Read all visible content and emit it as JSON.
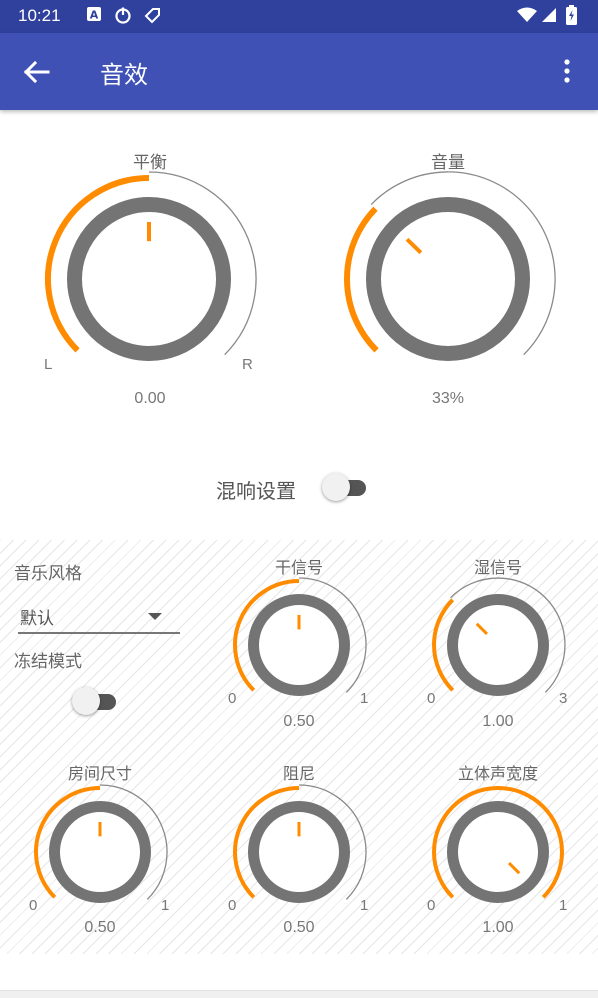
{
  "status_bar": {
    "time": "10:21",
    "left_icons": [
      "a-letter-icon",
      "power-timer-icon",
      "tag-icon"
    ],
    "right_icons": [
      "wifi-icon",
      "signal-icon",
      "battery-charging-icon"
    ]
  },
  "app_bar": {
    "title": "音效",
    "back_icon": "arrow-left-icon",
    "menu_icon": "more-vertical-icon"
  },
  "colors": {
    "app_bar": "#3f51b5",
    "status_bar": "#2f419d",
    "accent": "#ff8c00",
    "knob_ring": "#747474"
  },
  "balance": {
    "title": "平衡",
    "left_label": "L",
    "right_label": "R",
    "value": "0.00",
    "fraction": 0.5
  },
  "volume": {
    "title": "音量",
    "value": "33%",
    "fraction": 0.33
  },
  "reverb_settings": {
    "label": "混响设置",
    "enabled": false,
    "style_label": "音乐风格",
    "style_value": "默认",
    "freeze_label": "冻结模式",
    "freeze_enabled": false,
    "knobs": [
      {
        "title": "干信号",
        "min": "0",
        "max": "1",
        "value": "0.50",
        "fraction": 0.5
      },
      {
        "title": "湿信号",
        "min": "0",
        "max": "3",
        "value": "1.00",
        "fraction": 0.333
      },
      {
        "title": "房间尺寸",
        "min": "0",
        "max": "1",
        "value": "0.50",
        "fraction": 0.5
      },
      {
        "title": "阻尼",
        "min": "0",
        "max": "1",
        "value": "0.50",
        "fraction": 0.5
      },
      {
        "title": "立体声宽度",
        "min": "0",
        "max": "1",
        "value": "1.00",
        "fraction": 1.0
      }
    ]
  }
}
